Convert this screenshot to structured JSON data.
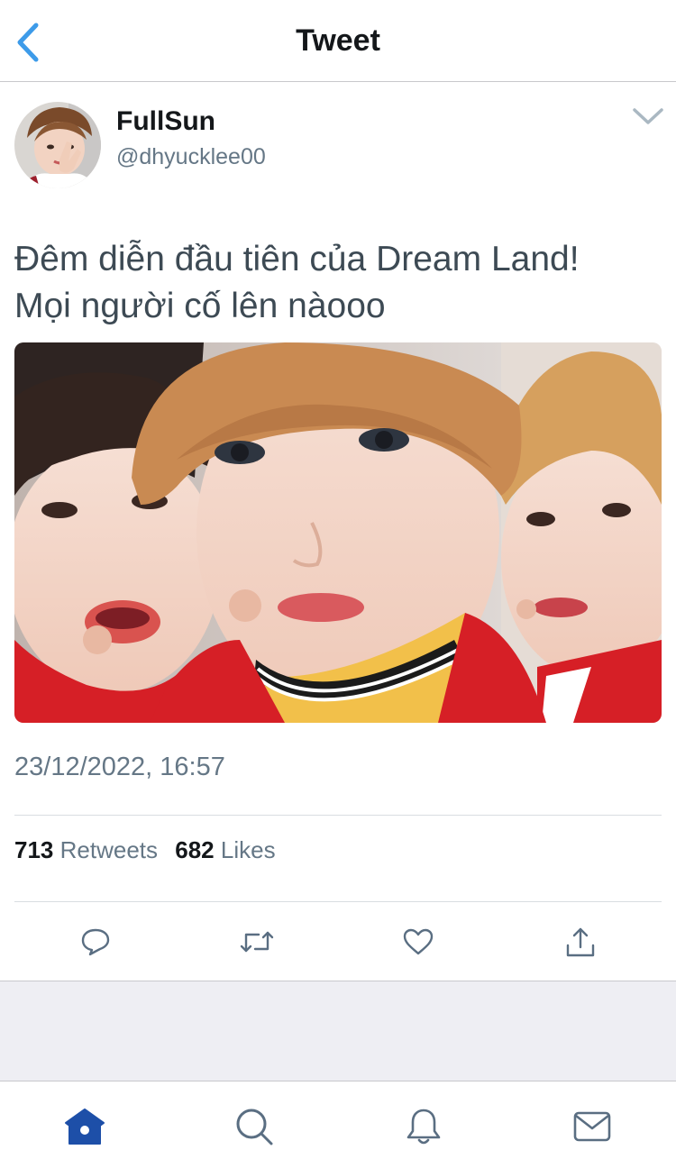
{
  "header": {
    "title": "Tweet",
    "back_icon": "chevron-left-icon"
  },
  "author": {
    "display_name": "FullSun",
    "handle": "@dhyucklee00"
  },
  "tweet": {
    "text_line1": "Đêm diễn đầu tiên của Dream Land!",
    "text_line2": "Mọi người cố lên nàooo",
    "timestamp": "23/12/2022, 16:57",
    "retweets_count": "713",
    "retweets_label": "Retweets",
    "likes_count": "682",
    "likes_label": "Likes"
  },
  "actions": [
    "reply-icon",
    "retweet-icon",
    "like-icon",
    "share-icon"
  ],
  "tabbar": [
    "home-icon",
    "search-icon",
    "notifications-icon",
    "messages-icon"
  ],
  "colors": {
    "accent": "#1da1f2",
    "active_tab": "#1d4fa8",
    "muted": "#657786",
    "icon": "#5a6e82"
  }
}
